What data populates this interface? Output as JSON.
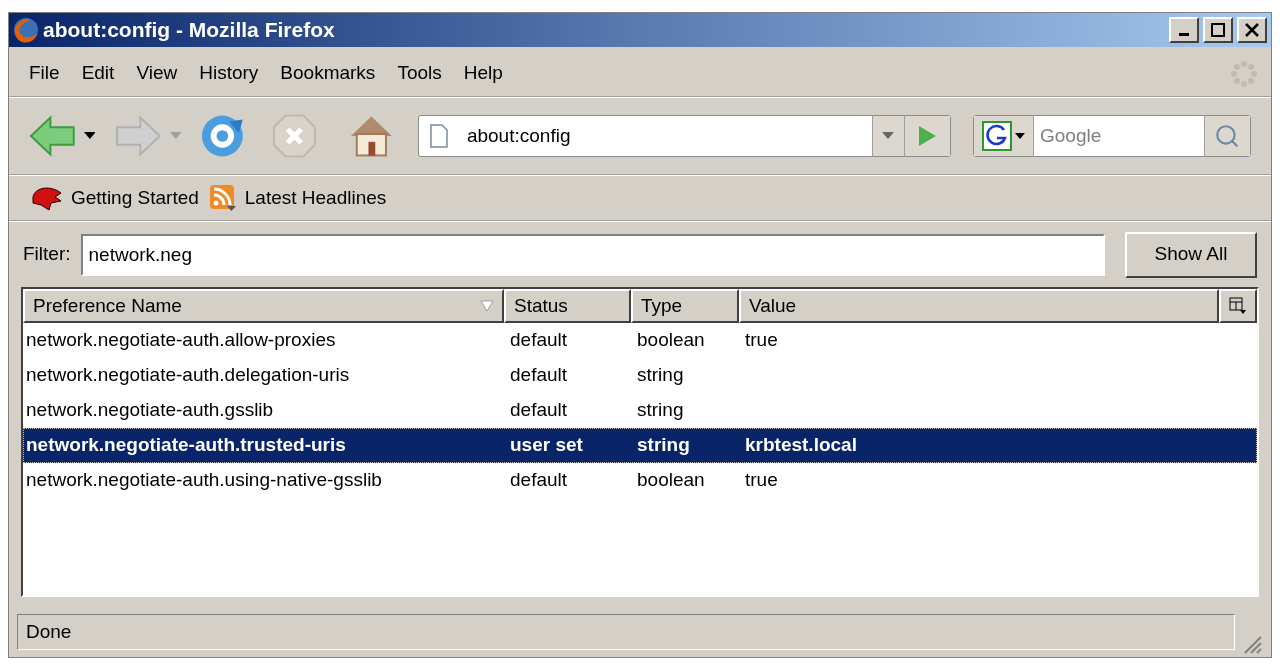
{
  "window": {
    "title": "about:config - Mozilla Firefox"
  },
  "menu": [
    "File",
    "Edit",
    "View",
    "History",
    "Bookmarks",
    "Tools",
    "Help"
  ],
  "address": {
    "value": "about:config"
  },
  "search": {
    "placeholder": "Google"
  },
  "bookmarks": [
    {
      "label": "Getting Started",
      "kind": "dino"
    },
    {
      "label": "Latest Headlines",
      "kind": "feed"
    }
  ],
  "filter": {
    "label": "Filter:",
    "value": "network.neg"
  },
  "show_all_button": "Show All",
  "table": {
    "columns": [
      "Preference Name",
      "Status",
      "Type",
      "Value"
    ],
    "rows": [
      {
        "name": "network.negotiate-auth.allow-proxies",
        "status": "default",
        "type": "boolean",
        "value": "true",
        "modified": false,
        "selected": false
      },
      {
        "name": "network.negotiate-auth.delegation-uris",
        "status": "default",
        "type": "string",
        "modified": false,
        "selected": false
      },
      {
        "name": "network.negotiate-auth.gsslib",
        "status": "default",
        "type": "string",
        "modified": false,
        "selected": false
      },
      {
        "name": "network.negotiate-auth.trusted-uris",
        "status": "user set",
        "type": "string",
        "value": "krbtest.local",
        "modified": true,
        "selected": true
      },
      {
        "name": "network.negotiate-auth.using-native-gsslib",
        "status": "default",
        "type": "boolean",
        "value": "true",
        "modified": false,
        "selected": false
      }
    ]
  },
  "status_bar": "Done"
}
